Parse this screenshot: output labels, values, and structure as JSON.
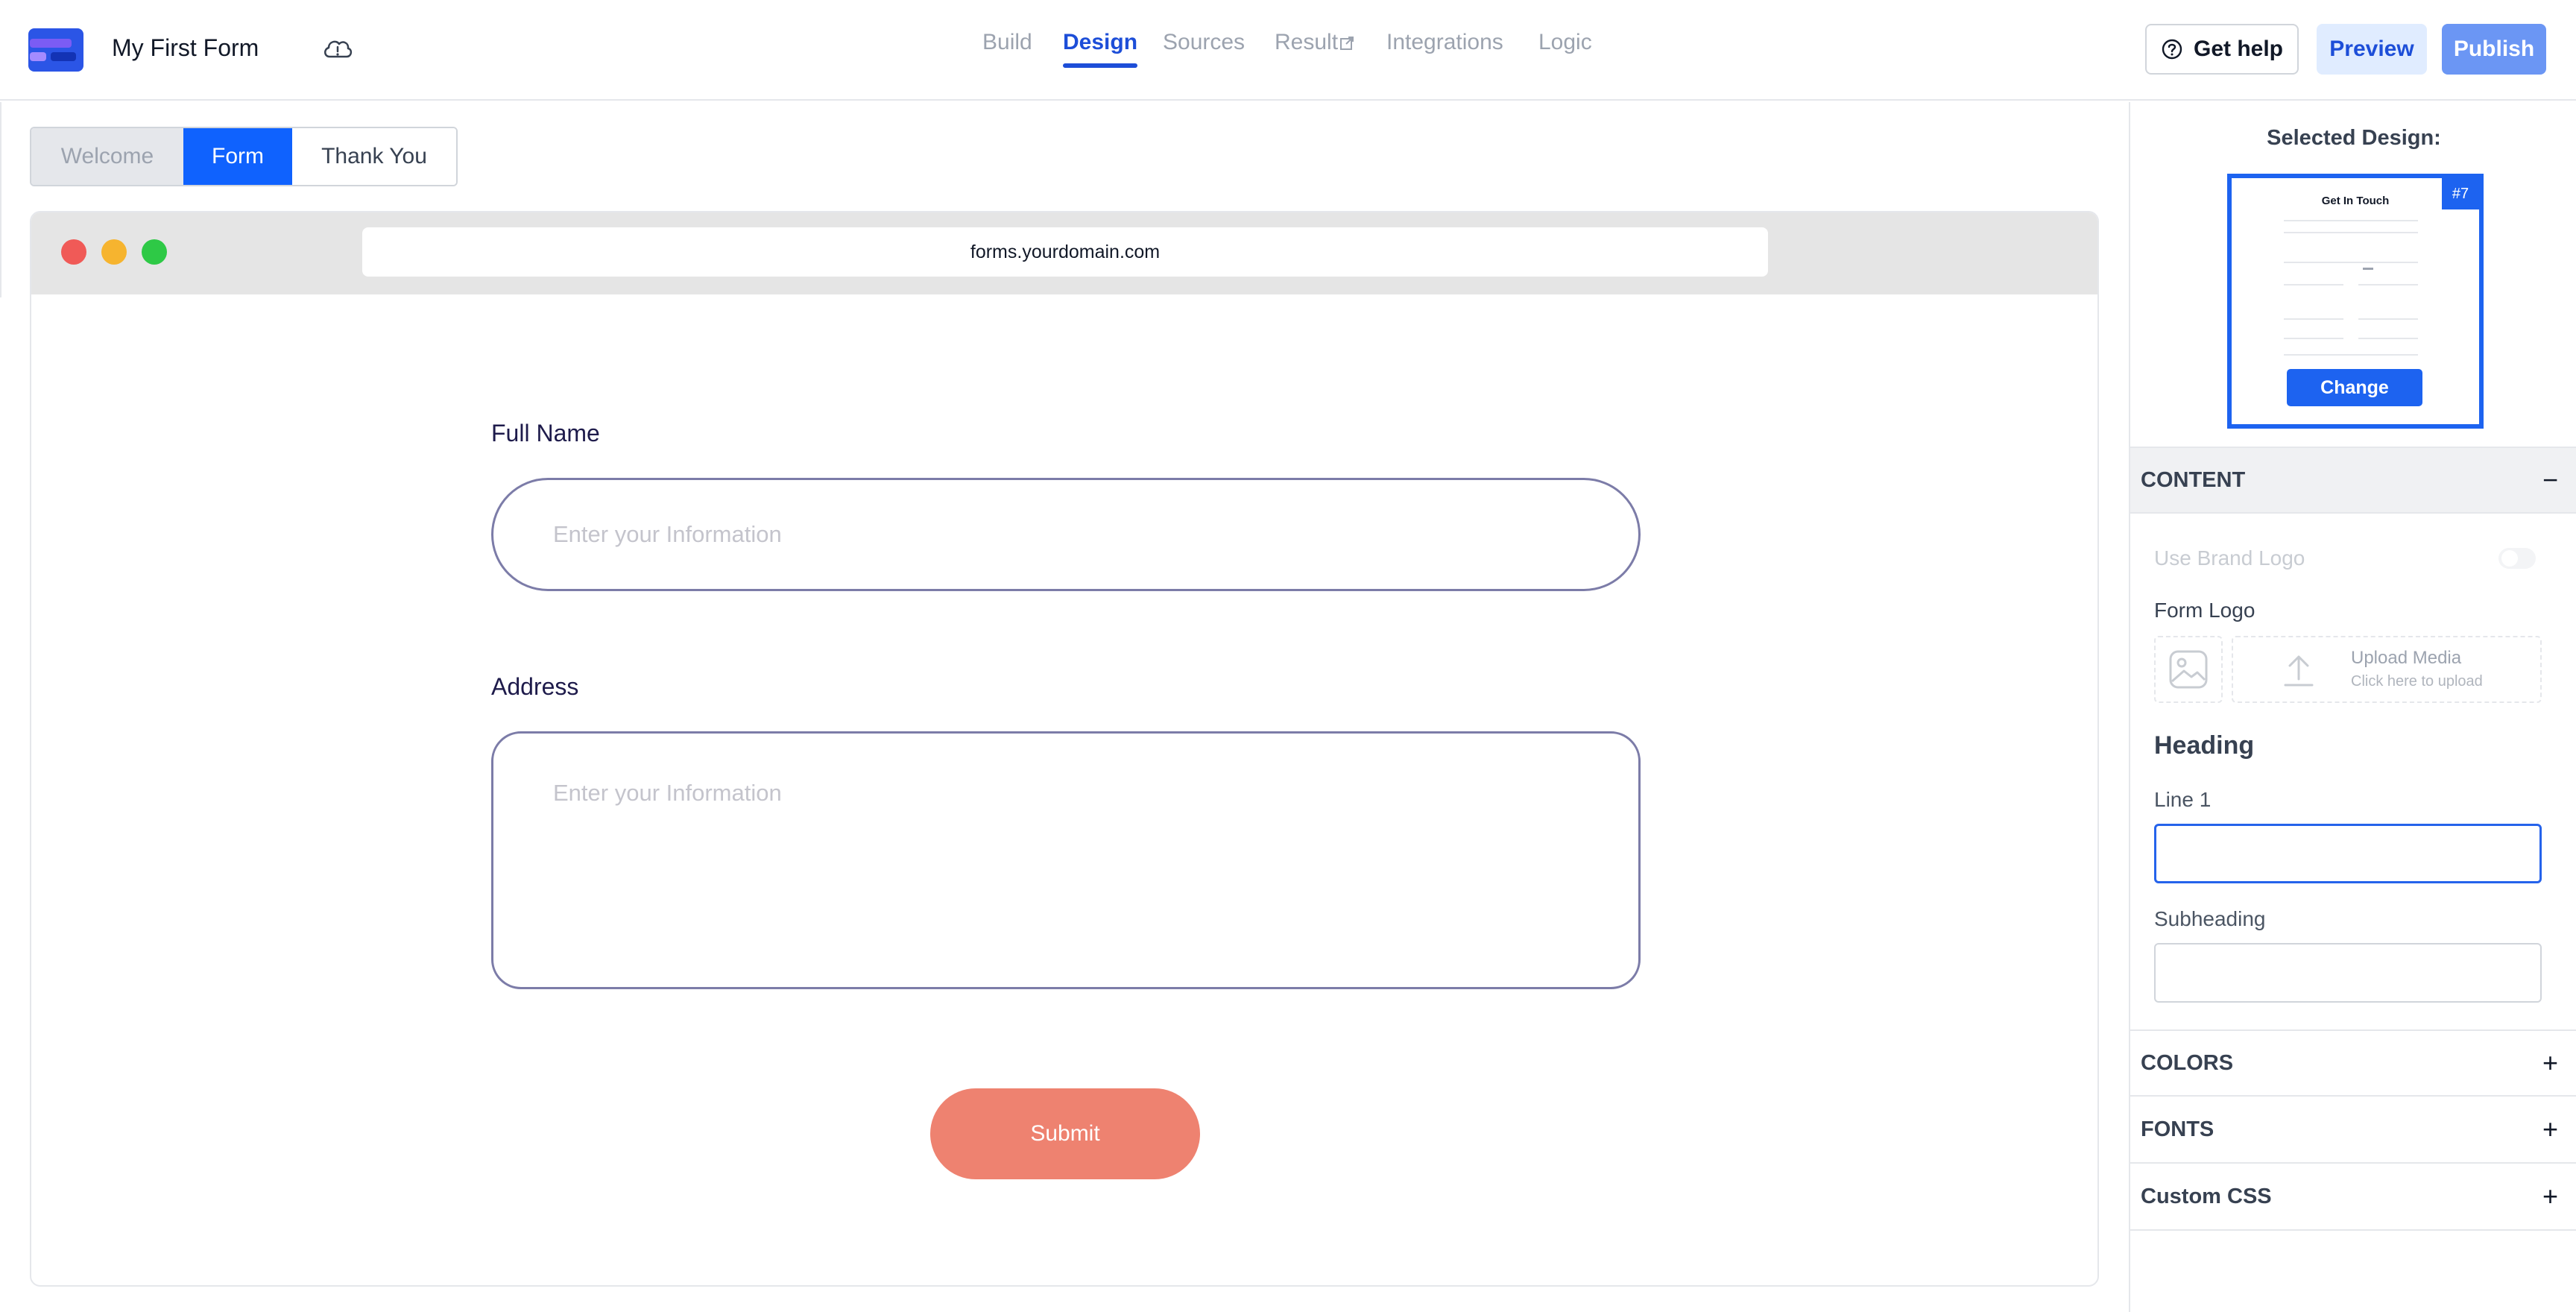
{
  "header": {
    "form_title": "My First Form",
    "nav": [
      "Build",
      "Design",
      "Sources",
      "Result",
      "Integrations",
      "Logic"
    ],
    "active_nav": "Design",
    "help_label": "Get help",
    "preview_label": "Preview",
    "publish_label": "Publish"
  },
  "screen_tabs": {
    "welcome": "Welcome",
    "form": "Form",
    "thank_you": "Thank You",
    "active": "Form"
  },
  "browser": {
    "url": "forms.yourdomain.com"
  },
  "form": {
    "fields": [
      {
        "label": "Full Name",
        "placeholder": "Enter your Information",
        "value": ""
      },
      {
        "label": "Address",
        "placeholder": "Enter your Information",
        "value": ""
      }
    ],
    "submit_label": "Submit"
  },
  "panel": {
    "selected_title": "Selected Design:",
    "design_badge": "#7",
    "thumb_heading": "Get In Touch",
    "change_label": "Change",
    "content_section": {
      "title": "CONTENT",
      "toggle": "−",
      "use_brand_logo": "Use Brand Logo",
      "form_logo_label": "Form Logo",
      "upload_title": "Upload Media",
      "upload_sub": "Click here to upload",
      "heading_label": "Heading",
      "line1_label": "Line 1",
      "line1_value": "",
      "subheading_label": "Subheading",
      "subheading_value": ""
    },
    "sections": [
      {
        "title": "COLORS",
        "toggle": "+"
      },
      {
        "title": "FONTS",
        "toggle": "+"
      },
      {
        "title": "Custom CSS",
        "toggle": "+"
      }
    ]
  },
  "colors": {
    "accent": "#0f62fe",
    "publish_bg": "#6b96f4",
    "submit_bg": "#ee8270",
    "input_border": "#7c7ca8"
  }
}
